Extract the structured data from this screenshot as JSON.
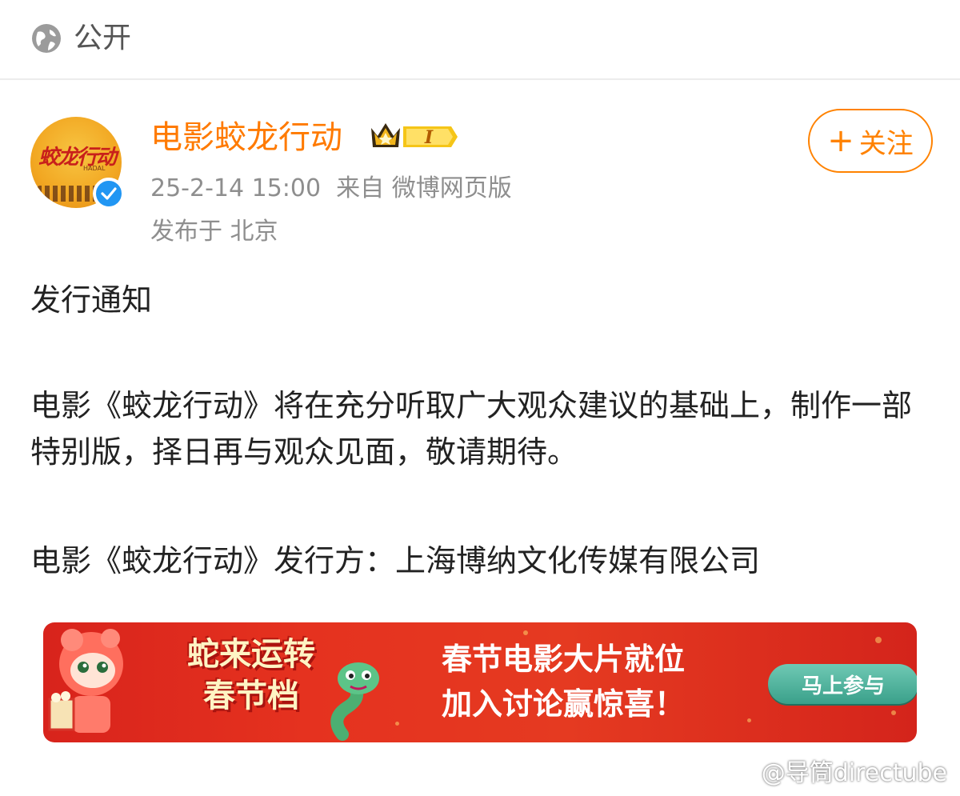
{
  "header": {
    "visibility_icon": "globe-icon",
    "visibility_label": "公开"
  },
  "post": {
    "author": {
      "name": "电影蛟龙行动",
      "avatar_logo_text": "蛟龙行动",
      "avatar_tag": "HADAL",
      "verified_icon": "verified-check-icon",
      "member_badge_icon": "crown-icon",
      "member_badge_level": "I"
    },
    "timestamp": "25-2-14 15:00",
    "source": "来自 微博网页版",
    "location": "发布于 北京",
    "follow_label": "关注",
    "follow_icon": "plus-icon",
    "body": {
      "title": "发行通知",
      "paragraph_1": "电影《蛟龙行动》将在充分听取广大观众建议的基础上，制作一部特别版，择日再与观众见面，敬请期待。",
      "paragraph_2": "电影《蛟龙行动》发行方：上海博纳文化传媒有限公司"
    }
  },
  "banner": {
    "title_line_1": "蛇来运转",
    "title_line_2": "春节档",
    "headline_line_1": "春节电影大片就位",
    "headline_line_2": "加入讨论赢惊喜！",
    "cta_label": "马上参与"
  },
  "watermark": {
    "icon": "weibo-logo-icon",
    "text": "@导筒directube"
  },
  "colors": {
    "accent": "#ff8200",
    "username": "#ff7a00",
    "meta_gray": "#8e8e8e",
    "verified": "#2196f3",
    "banner_red": "#e5321f",
    "cta_green": "#3aa08a"
  }
}
